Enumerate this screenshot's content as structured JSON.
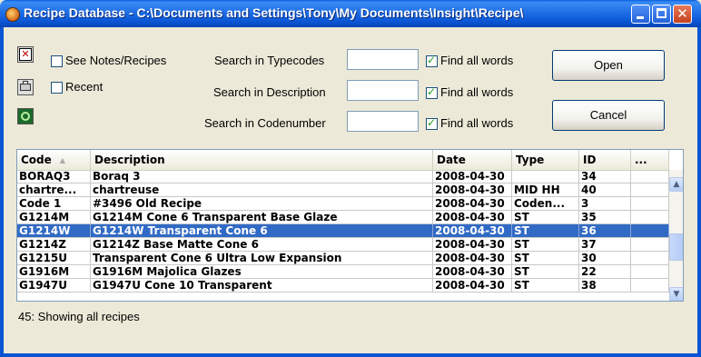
{
  "window": {
    "title": "Recipe Database - C:\\Documents and Settings\\Tony\\My Documents\\Insight\\Recipe\\",
    "close_glyph": "✕"
  },
  "options": {
    "see_notes_label": "See Notes/Recipes",
    "see_notes_checked": false,
    "recent_label": "Recent",
    "recent_checked": false
  },
  "search": {
    "typecodes": {
      "label": "Search in Typecodes",
      "value": "",
      "find_all_label": "Find all words",
      "find_all_checked": true
    },
    "description": {
      "label": "Search in Description",
      "value": "",
      "find_all_label": "Find all words",
      "find_all_checked": true
    },
    "codenumber": {
      "label": "Search in Codenumber",
      "value": "",
      "find_all_label": "Find all words",
      "find_all_checked": true
    }
  },
  "buttons": {
    "open": "Open",
    "cancel": "Cancel"
  },
  "table": {
    "columns": [
      "Code",
      "Description",
      "Date",
      "Type",
      "ID",
      "..."
    ],
    "sort_indicator": "▲",
    "rows": [
      {
        "code": "BORAQ3",
        "description": "Boraq 3",
        "date": "2008-04-30",
        "type": "",
        "id": "34",
        "extra": "",
        "selected": false
      },
      {
        "code": "chartre...",
        "description": "chartreuse",
        "date": "2008-04-30",
        "type": "MID HH",
        "id": "40",
        "extra": "",
        "selected": false
      },
      {
        "code": "Code 1",
        "description": "#3496 Old Recipe",
        "date": "2008-04-30",
        "type": "Coden...",
        "id": "3",
        "extra": "",
        "selected": false
      },
      {
        "code": "G1214M",
        "description": "G1214M Cone 6 Transparent Base Glaze",
        "date": "2008-04-30",
        "type": "ST",
        "id": "35",
        "extra": "",
        "selected": false
      },
      {
        "code": "G1214W",
        "description": "G1214W Transparent Cone 6",
        "date": "2008-04-30",
        "type": "ST",
        "id": "36",
        "extra": "",
        "selected": true
      },
      {
        "code": "G1214Z",
        "description": "G1214Z Base Matte Cone 6",
        "date": "2008-04-30",
        "type": "ST",
        "id": "37",
        "extra": "",
        "selected": false
      },
      {
        "code": "G1215U",
        "description": "Transparent Cone 6 Ultra Low Expansion",
        "date": "2008-04-30",
        "type": "ST",
        "id": "30",
        "extra": "",
        "selected": false
      },
      {
        "code": "G1916M",
        "description": "G1916M Majolica Glazes",
        "date": "2008-04-30",
        "type": "ST",
        "id": "22",
        "extra": "",
        "selected": false
      },
      {
        "code": "G1947U",
        "description": "G1947U Cone 10 Transparent",
        "date": "2008-04-30",
        "type": "ST",
        "id": "38",
        "extra": "",
        "selected": false
      }
    ]
  },
  "scroll": {
    "up_glyph": "▲",
    "down_glyph": "▼"
  },
  "status": "45: Showing all recipes",
  "colors": {
    "titlebar": "#0b55d4",
    "selection": "#316ac5",
    "check": "#21a121",
    "window_bg": "#ece9d8"
  }
}
